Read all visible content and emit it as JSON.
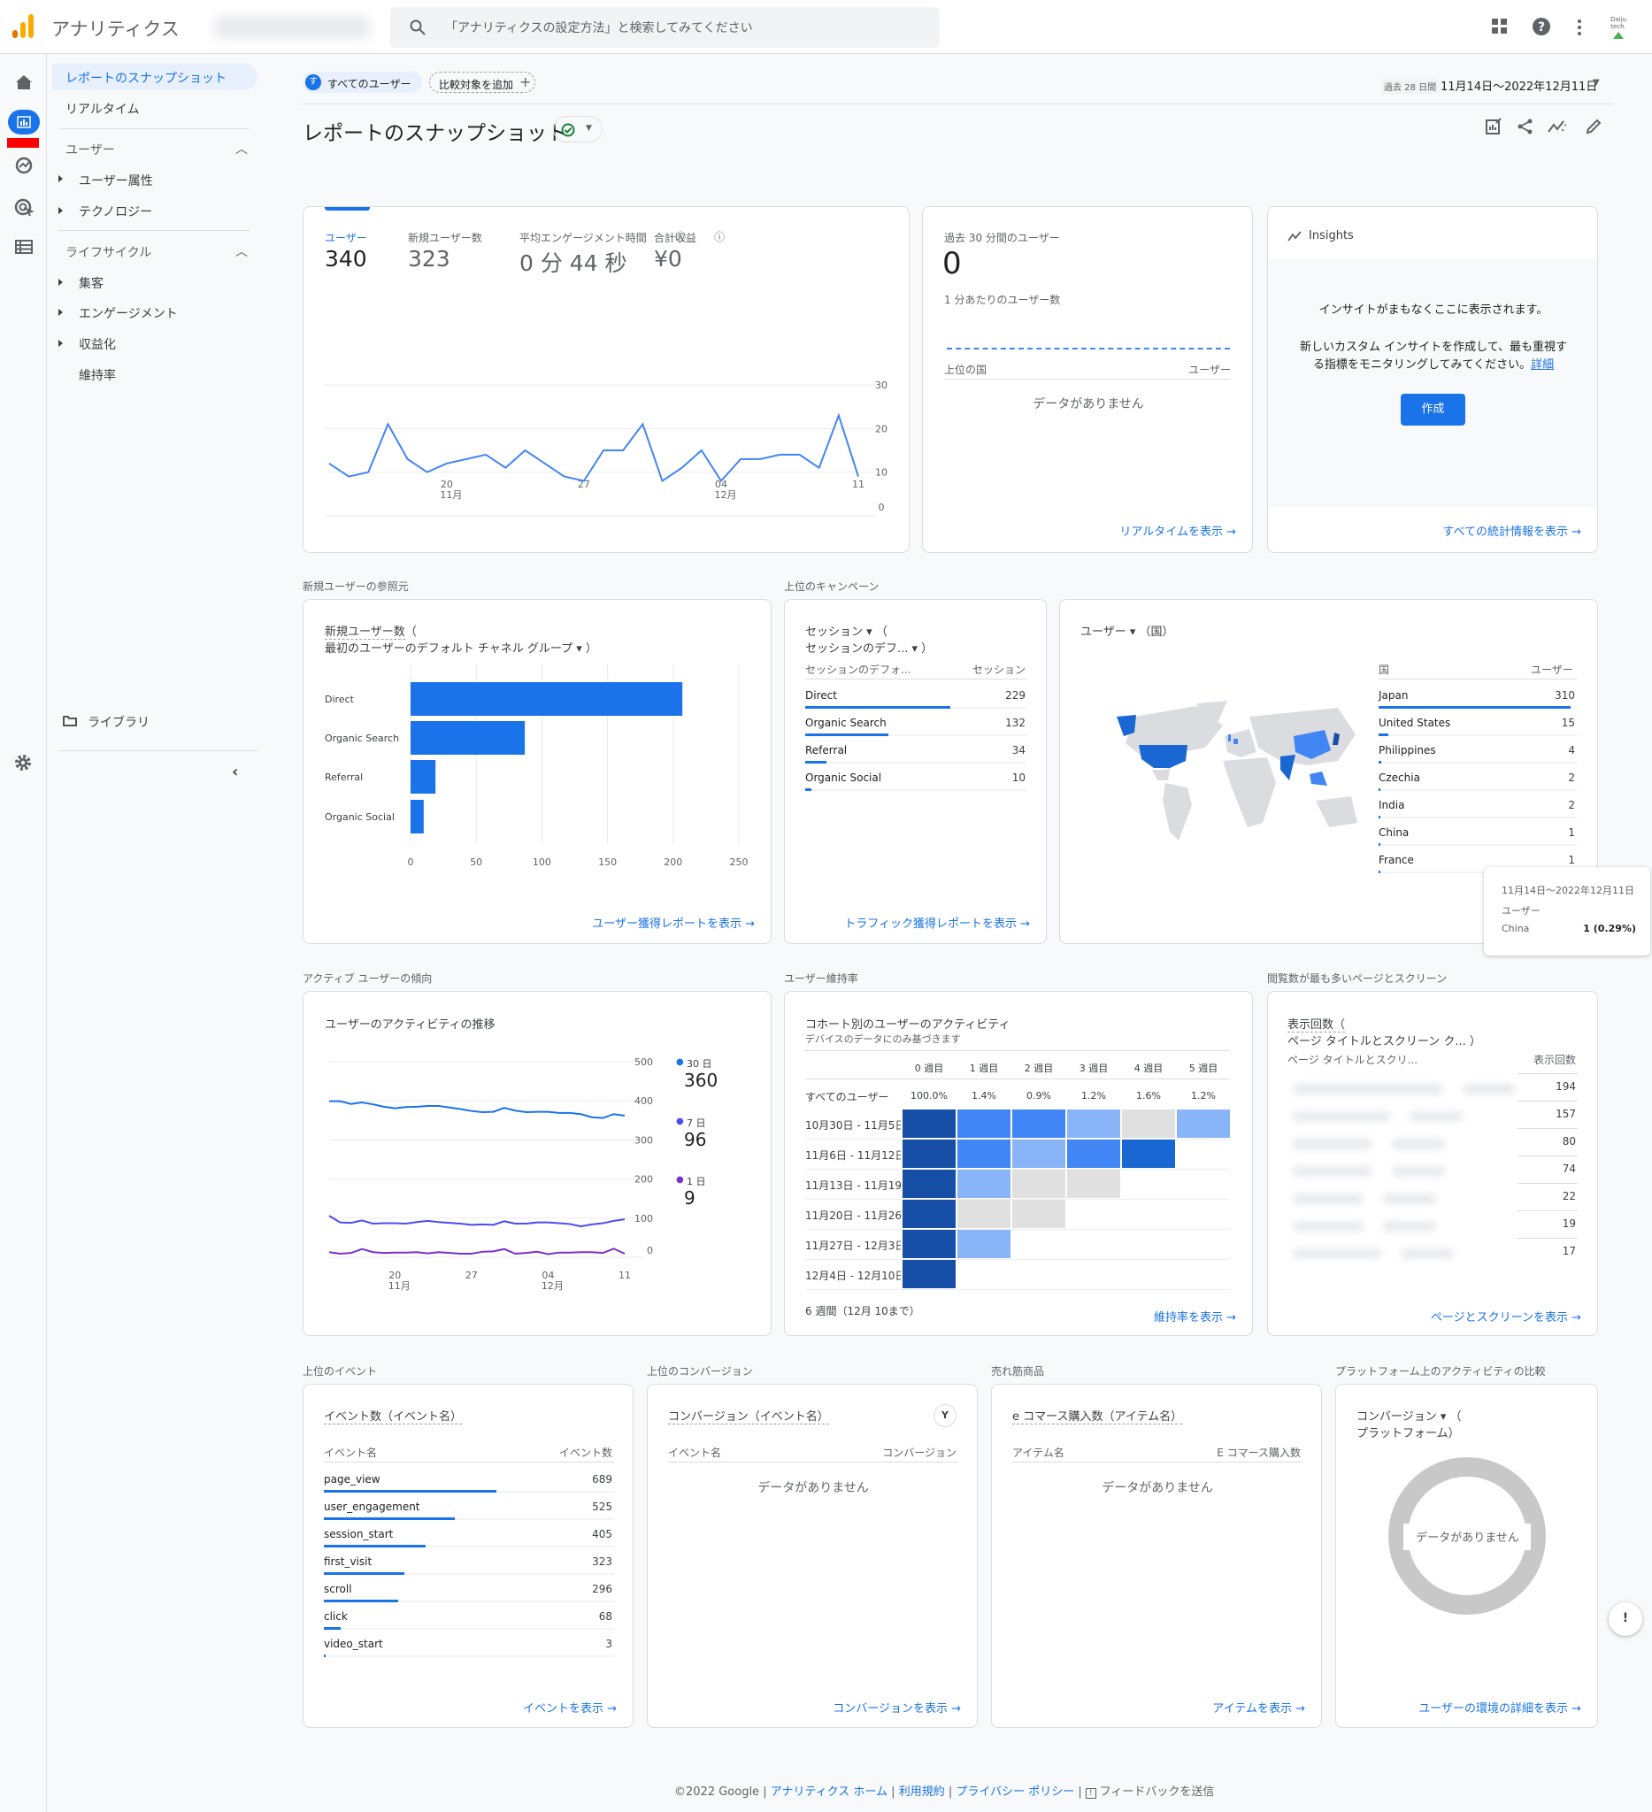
{
  "app": {
    "title": "アナリティクス",
    "search_placeholder": "「アナリティクスの設定方法」と検索してみてください",
    "avatar_text": "Daiju tech."
  },
  "rail": {
    "icons": [
      "home-icon",
      "reports-icon",
      "explore-icon",
      "advertising-icon",
      "configure-icon",
      "settings-icon"
    ]
  },
  "sidebar": {
    "active": "レポートのスナップショット",
    "realtime": "リアルタイム",
    "group_user": "ユーザー",
    "user_items": [
      "ユーザー属性",
      "テクノロジー"
    ],
    "group_lifecycle": "ライフサイクル",
    "lifecycle_items": [
      "集客",
      "エンゲージメント",
      "収益化",
      "維持率"
    ],
    "library": "ライブラリ"
  },
  "header": {
    "segment_badge": "す",
    "segment": "すべてのユーザー",
    "compare": "比較対象を追加",
    "date_prefix": "過去 28 日間",
    "date_range": "11月14日～2022年12月11日",
    "page_title": "レポートのスナップショット"
  },
  "colors": {
    "accent": "#1a73e8",
    "cohort": {
      "d": "#174ea6",
      "s": "#1967d2",
      "m": "#4285f4",
      "l": "#8ab4f8",
      "g": "#e0e0e0"
    },
    "series30": "#1a73e8",
    "series7": "#4c4cf5",
    "series1": "#7b2fd1"
  },
  "overview": {
    "metrics": [
      {
        "label": "ユーザー",
        "value": "340"
      },
      {
        "label": "新規ユーザー数",
        "value": "323"
      },
      {
        "label": "平均エンゲージメント時間",
        "value": "0 分 44 秒"
      },
      {
        "label": "合計収益",
        "value": "¥0"
      }
    ],
    "chart_data": {
      "type": "line",
      "x_ticks": [
        {
          "day": "20",
          "month": "11月",
          "index": 6
        },
        {
          "day": "27",
          "month": "",
          "index": 13
        },
        {
          "day": "04",
          "month": "12月",
          "index": 20
        },
        {
          "day": "11",
          "month": "",
          "index": 27
        }
      ],
      "y_ticks": [
        0,
        10,
        20,
        30
      ],
      "ylim": [
        0,
        30
      ],
      "values": [
        12,
        9,
        10,
        21,
        13,
        10,
        12,
        13,
        14,
        11,
        15,
        12,
        9,
        8,
        15,
        15,
        21,
        8,
        11,
        15,
        8,
        13,
        13,
        14,
        14,
        11,
        23,
        9
      ]
    }
  },
  "realtime": {
    "title": "過去 30 分間のユーザー",
    "value": "0",
    "subtitle": "1 分あたりのユーザー数",
    "col_country": "上位の国",
    "col_users": "ユーザー",
    "empty": "データがありません",
    "link": "リアルタイムを表示"
  },
  "insights": {
    "title": "Insights",
    "line1": "インサイトがまもなくここに表示されます。",
    "line2": "新しいカスタム インサイトを作成して、最も重視す",
    "line3": "る指標をモニタリングしてみてください。",
    "detail_link": "詳細",
    "button": "作成",
    "link": "すべての統計情報を表示"
  },
  "new_users": {
    "section": "新規ユーザーの参照元",
    "title1": "新規ユーザー数",
    "title1_paren": "（",
    "title2": "最初のユーザーのデフォルト チャネル グループ ▾ ）",
    "link": "ユーザー獲得レポートを表示",
    "chart_data": {
      "type": "bar",
      "orientation": "horizontal",
      "categories": [
        "Direct",
        "Organic Search",
        "Referral",
        "Organic Social"
      ],
      "values": [
        207,
        87,
        19,
        10
      ],
      "x_ticks": [
        0,
        50,
        100,
        150,
        200,
        250
      ],
      "xlim": [
        0,
        250
      ]
    }
  },
  "campaign": {
    "section": "上位のキャンペーン",
    "title1": "セッション ▾ （",
    "title2": "セッションのデフ... ▾ ）",
    "col1": "セッションのデフォ...",
    "col2": "セッション",
    "rows": [
      {
        "name": "Direct",
        "value": 229
      },
      {
        "name": "Organic Search",
        "value": 132
      },
      {
        "name": "Referral",
        "value": 34
      },
      {
        "name": "Organic Social",
        "value": 10
      }
    ],
    "link": "トラフィック獲得レポートを表示"
  },
  "country": {
    "title": "ユーザー ▾ （国）",
    "col1": "国",
    "col2": "ユーザー",
    "rows": [
      {
        "name": "Japan",
        "value": 310
      },
      {
        "name": "United States",
        "value": 15
      },
      {
        "name": "Philippines",
        "value": 4
      },
      {
        "name": "Czechia",
        "value": 2
      },
      {
        "name": "India",
        "value": 2
      },
      {
        "name": "China",
        "value": 1
      },
      {
        "name": "France",
        "value": 1
      }
    ],
    "tooltip": {
      "date": "11月14日～2022年12月11日",
      "metric": "ユーザー",
      "country": "China",
      "value": "1 (0.29%)"
    }
  },
  "active": {
    "section": "アクティブ ユーザーの傾向",
    "title": "ユーザーのアクティビティの推移",
    "legend": [
      {
        "label": "30 日",
        "value": "360"
      },
      {
        "label": "7 日",
        "value": "96"
      },
      {
        "label": "1 日",
        "value": "9"
      }
    ],
    "chart_data": {
      "type": "line",
      "y_ticks": [
        0,
        100,
        200,
        300,
        400,
        500
      ],
      "ylim": [
        0,
        500
      ],
      "x_ticks": [
        {
          "day": "20",
          "month": "11月",
          "index": 6
        },
        {
          "day": "27",
          "month": "",
          "index": 13
        },
        {
          "day": "04",
          "month": "12月",
          "index": 20
        },
        {
          "day": "11",
          "month": "",
          "index": 27
        }
      ],
      "series": [
        {
          "name": "30 日",
          "values": [
            399,
            399,
            392,
            396,
            391,
            385,
            381,
            384,
            385,
            387,
            387,
            383,
            379,
            374,
            371,
            372,
            382,
            375,
            371,
            372,
            372,
            369,
            369,
            366,
            358,
            356,
            366,
            362
          ]
        },
        {
          "name": "7 日",
          "values": [
            106,
            89,
            88,
            94,
            86,
            87,
            87,
            86,
            90,
            93,
            90,
            88,
            86,
            83,
            84,
            83,
            92,
            86,
            86,
            89,
            89,
            87,
            85,
            79,
            84,
            87,
            93,
            97
          ]
        },
        {
          "name": "1 日",
          "values": [
            13,
            9,
            11,
            21,
            13,
            11,
            12,
            12,
            13,
            10,
            13,
            11,
            9,
            9,
            14,
            15,
            21,
            9,
            11,
            14,
            8,
            12,
            12,
            13,
            13,
            11,
            22,
            9
          ]
        }
      ]
    }
  },
  "retention": {
    "section": "ユーザー維持率",
    "title": "コホート別のユーザーのアクティビティ",
    "subtitle": "デバイスのデータにのみ基づきます",
    "chart_data": {
      "type": "heatmap",
      "columns": [
        "0 週目",
        "1 週目",
        "2 週目",
        "3 週目",
        "4 週目",
        "5 週目"
      ],
      "all_label": "すべてのユーザー",
      "all_values": [
        "100.0%",
        "1.4%",
        "0.9%",
        "1.2%",
        "1.6%",
        "1.2%"
      ],
      "rows": [
        {
          "label": "10月30日 - 11月5日",
          "levels": [
            "d",
            "m",
            "m",
            "l",
            "g",
            "l"
          ]
        },
        {
          "label": "11月6日 - 11月12日",
          "levels": [
            "d",
            "m",
            "l",
            "m",
            "s"
          ]
        },
        {
          "label": "11月13日 - 11月19日",
          "levels": [
            "d",
            "l",
            "g",
            "g"
          ]
        },
        {
          "label": "11月20日 - 11月26日",
          "levels": [
            "d",
            "g",
            "g"
          ]
        },
        {
          "label": "11月27日 - 12月3日",
          "levels": [
            "d",
            "l"
          ]
        },
        {
          "label": "12月4日 - 12月10日",
          "levels": [
            "d"
          ]
        }
      ]
    },
    "footer": "6 週間（12月 10まで）",
    "link": "維持率を表示"
  },
  "pages": {
    "section": "閲覧数が最も多いページとスクリーン",
    "title1": "表示回数（",
    "title2": "ページ タイトルとスクリーン ク...  ）",
    "col1": "ページ タイトルとスクリ...",
    "col2": "表示回数",
    "values": [
      194,
      157,
      80,
      74,
      22,
      19,
      17
    ],
    "link": "ページとスクリーンを表示"
  },
  "events": {
    "section": "上位のイベント",
    "title": "イベント数（イベント名）",
    "col1": "イベント名",
    "col2": "イベント数",
    "rows": [
      {
        "name": "page_view",
        "value": 689
      },
      {
        "name": "user_engagement",
        "value": 525
      },
      {
        "name": "session_start",
        "value": 405
      },
      {
        "name": "first_visit",
        "value": 323
      },
      {
        "name": "scroll",
        "value": 296
      },
      {
        "name": "click",
        "value": 68
      },
      {
        "name": "video_start",
        "value": 3
      }
    ],
    "link": "イベントを表示"
  },
  "conversions": {
    "section": "上位のコンバージョン",
    "title": "コンバージョン（イベント名）",
    "col1": "イベント名",
    "col2": "コンバージョン",
    "empty": "データがありません",
    "link": "コンバージョンを表示"
  },
  "items": {
    "section": "売れ筋商品",
    "title": "e コマース購入数（アイテム名）",
    "col1": "アイテム名",
    "col2": "E コマース購入数",
    "empty": "データがありません",
    "link": "アイテムを表示"
  },
  "platform": {
    "section": "プラットフォーム上のアクティビティの比較",
    "title1": "コンバージョン ▾ （",
    "title2": "プラットフォーム）",
    "empty": "データがありません",
    "link": "ユーザーの環境の詳細を表示"
  },
  "footer": {
    "copyright": "©2022 Google |",
    "home": "アナリティクス ホーム",
    "sep": "|",
    "terms": "利用規約",
    "privacy": "プライバシー ポリシー",
    "sep2": "|",
    "feedback": "フィードバックを送信"
  }
}
